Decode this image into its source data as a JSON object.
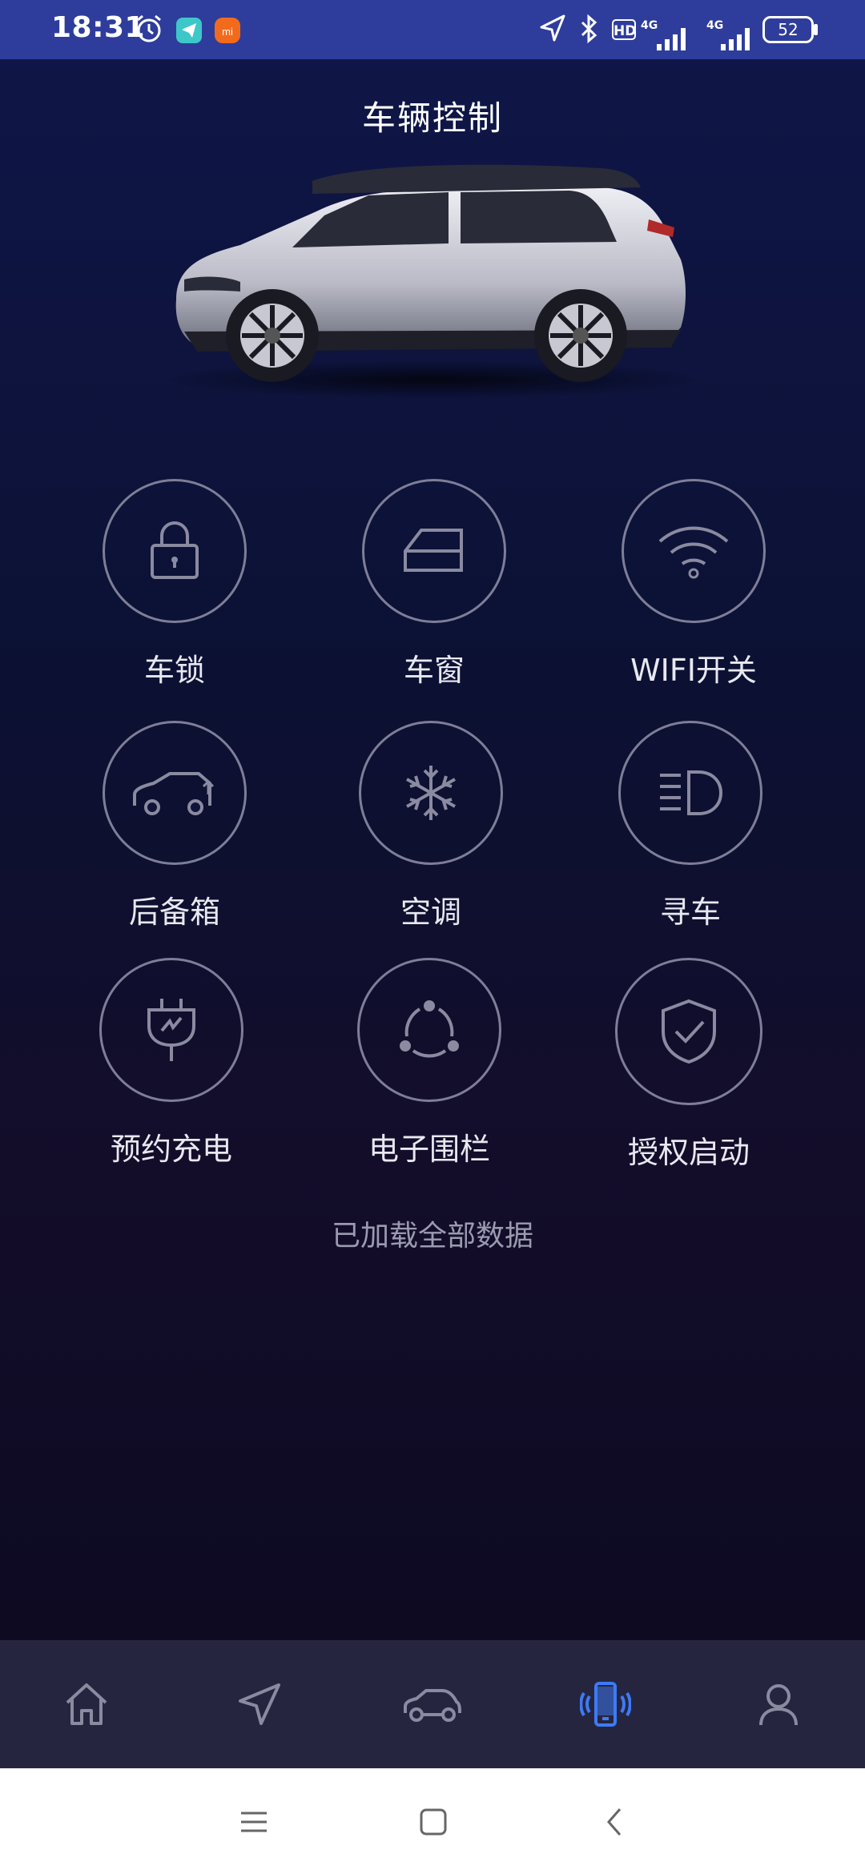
{
  "status_bar": {
    "time": "18:31",
    "battery": "52",
    "hd": "HD",
    "net1": "4G",
    "net2": "4G",
    "xiaomi": "mi"
  },
  "header": {
    "title": "车辆控制"
  },
  "controls": [
    {
      "label": "车锁",
      "icon": "lock-icon"
    },
    {
      "label": "车窗",
      "icon": "window-icon"
    },
    {
      "label": "WIFI开关",
      "icon": "wifi-icon"
    },
    {
      "label": "后备箱",
      "icon": "trunk-icon"
    },
    {
      "label": "空调",
      "icon": "snowflake-icon"
    },
    {
      "label": "寻车",
      "icon": "headlight-icon"
    },
    {
      "label": "预约充电",
      "icon": "charging-plug-icon"
    },
    {
      "label": "电子围栏",
      "icon": "geofence-icon"
    },
    {
      "label": "授权启动",
      "icon": "shield-check-icon"
    }
  ],
  "footer_message": "已加载全部数据",
  "tab_bar": {
    "active_index": 3,
    "active_color": "#3d7bf5",
    "inactive_color": "#8a8aa0",
    "tabs": [
      "home-icon",
      "navigation-icon",
      "car-icon",
      "phone-vibrate-icon",
      "profile-icon"
    ]
  },
  "system_nav": [
    "menu-icon",
    "home-square-icon",
    "back-icon"
  ]
}
